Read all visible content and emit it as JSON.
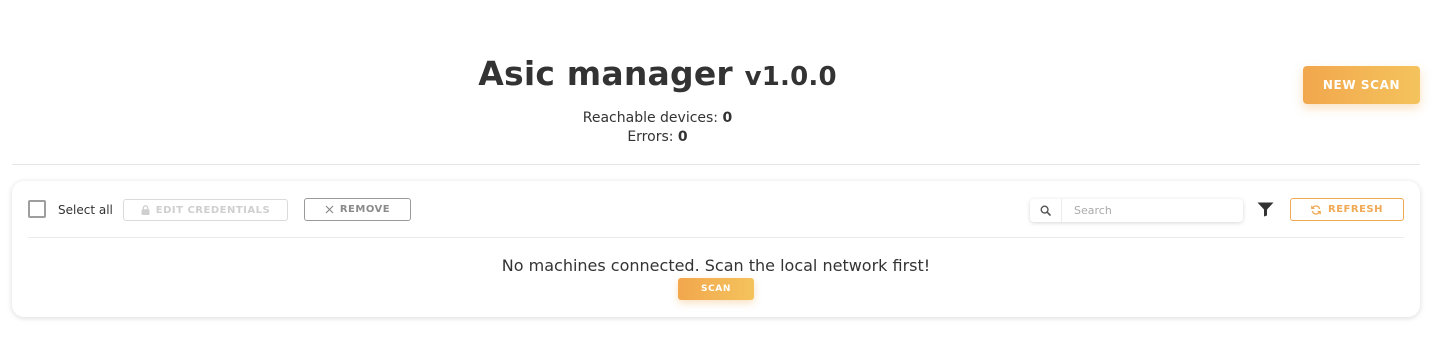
{
  "header": {
    "title": "Asic manager",
    "version": "v1.0.0",
    "reachable_label": "Reachable devices:",
    "reachable_count": "0",
    "errors_label": "Errors:",
    "errors_count": "0",
    "new_scan_label": "NEW SCAN"
  },
  "toolbar": {
    "select_all_label": "Select all",
    "select_all_checked": false,
    "edit_credentials_label": "EDIT CREDENTIALS",
    "edit_credentials_icon": "lock-icon",
    "remove_label": "REMOVE",
    "remove_icon": "close-icon",
    "search_placeholder": "Search",
    "search_value": "",
    "filter_icon": "filter-icon",
    "refresh_label": "REFRESH",
    "refresh_icon": "refresh-icon"
  },
  "content": {
    "empty_message": "No machines connected. Scan the local network first!",
    "scan_label": "SCAN"
  },
  "colors": {
    "accent_start": "#f2a74d",
    "accent_end": "#f4c35d",
    "text": "#333333",
    "refresh_border": "#f0a955"
  }
}
